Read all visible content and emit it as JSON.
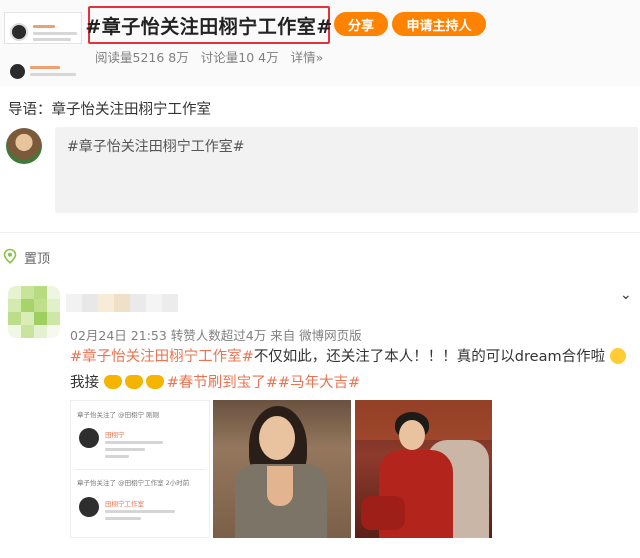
{
  "topic": {
    "title": "#章子怡关注田栩宁工作室#",
    "share_label": "分享",
    "apply_host_label": "申请主持人",
    "read_count": "阅读量5216 8万",
    "discuss_count": "讨论量10 4万",
    "detail_label": "详情",
    "detail_arrow": "»"
  },
  "intro": {
    "text": "导语：章子怡关注田栩宁工作室"
  },
  "composer": {
    "text": "#章子怡关注田栩宁工作室#"
  },
  "pinned": {
    "label": "置顶"
  },
  "post": {
    "meta": "02月24日 21:53 转赞人数超过4万  来自 微博网页版",
    "hashtag_1": "#章子怡关注田栩宁工作室#",
    "text_1": "不仅如此，还关注了本人！！！真的可以dream合作啦",
    "text_2": "我接",
    "hashtag_2": "#春节刷到宝了#",
    "hashtag_3": "#马年大吉#",
    "chevron": "⌄"
  },
  "screenshot": {
    "line_1": "章子怡关注了 @田栩宁 刚刚",
    "name_1": "田栩宁",
    "line_2": "章子怡关注了 @田栩宁工作室 2小时前",
    "name_2": "田栩宁工作室"
  },
  "colors": {
    "accent_orange": "#ff8200",
    "hashtag": "#eb7350",
    "highlight_border": "#e2323c"
  }
}
